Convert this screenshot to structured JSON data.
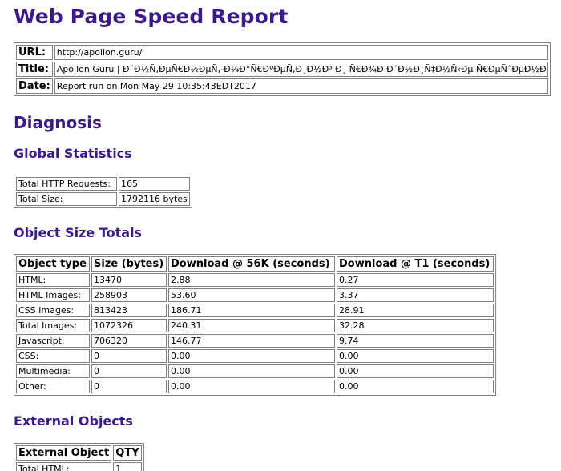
{
  "page": {
    "title": "Web Page Speed Report"
  },
  "meta": {
    "url_label": "URL:",
    "url": "http://apollon.guru/",
    "title_label": "Title:",
    "title": "Apollon Guru | Ð˜Ð½Ñ‚ÐµÑ€Ð½ÐµÑ‚-Ð¼Ð°Ñ€ÐºÐµÑ‚Ð¸Ð½Ð³ Ð¸ Ñ€Ð¾Ð·Ð´Ð½Ð¸Ñ‡Ð½Ñ‹Ðµ Ñ€ÐµÑˆÐµÐ½Ð¸Ñ",
    "date_label": "Date:",
    "date": "Report run on Mon May 29 10:35:43EDT2017"
  },
  "diagnosis": {
    "heading": "Diagnosis"
  },
  "global": {
    "heading": "Global Statistics",
    "rows": [
      {
        "label": "Total HTTP Requests:",
        "value": "165"
      },
      {
        "label": "Total Size:",
        "value": "1792116 bytes"
      }
    ]
  },
  "size_totals": {
    "heading": "Object Size Totals",
    "headers": [
      "Object type",
      "Size (bytes)",
      "Download @ 56K (seconds)",
      "Download @ T1 (seconds)"
    ],
    "rows": [
      [
        "HTML:",
        "13470",
        "2.88",
        "0.27"
      ],
      [
        "HTML Images:",
        "258903",
        "53.60",
        "3.37"
      ],
      [
        "CSS Images:",
        "813423",
        "186.71",
        "28.91"
      ],
      [
        "Total Images:",
        "1072326",
        "240.31",
        "32.28"
      ],
      [
        "Javascript:",
        "706320",
        "146.77",
        "9.74"
      ],
      [
        "CSS:",
        "0",
        "0.00",
        "0.00"
      ],
      [
        "Multimedia:",
        "0",
        "0.00",
        "0.00"
      ],
      [
        "Other:",
        "0",
        "0.00",
        "0.00"
      ]
    ]
  },
  "external": {
    "heading": "External Objects",
    "headers": [
      "External Object",
      "QTY"
    ],
    "rows": [
      [
        "Total HTML:",
        "1"
      ]
    ]
  }
}
